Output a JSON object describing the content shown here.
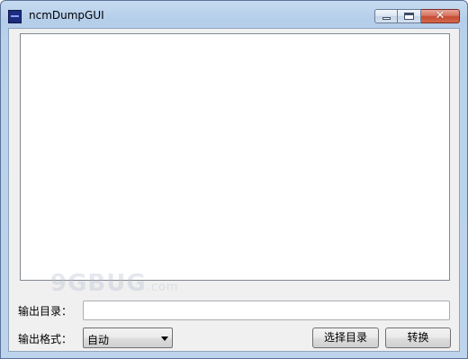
{
  "window": {
    "title": "ncmDumpGUI",
    "app_icon": "app-icon",
    "controls": {
      "minimize": "minimize-icon",
      "maximize": "maximize-icon",
      "close": "close-icon",
      "close_glyph": "✕"
    }
  },
  "log_list": {
    "items": []
  },
  "output_dir": {
    "label": "输出目录：",
    "value": "",
    "placeholder": ""
  },
  "output_format": {
    "label": "输出格式：",
    "selected": "自动",
    "arrow_icon": "chevron-down-icon"
  },
  "buttons": {
    "choose_dir": "选择目录",
    "convert": "转换"
  },
  "watermark": {
    "text": "9GBUG",
    "suffix": ".com"
  },
  "colors": {
    "title_bar": "#b9d1ea",
    "client_bg": "#f0f0f0",
    "close_button": "#c44b33"
  }
}
